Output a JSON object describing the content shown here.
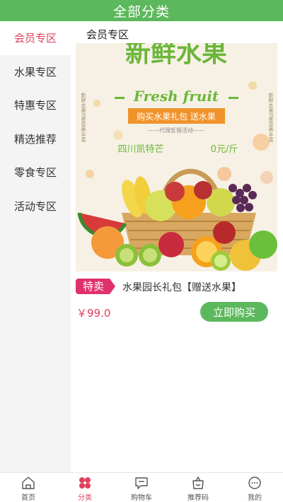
{
  "header": {
    "title": "全部分类"
  },
  "sidebar": {
    "items": [
      {
        "label": "会员专区",
        "active": true
      },
      {
        "label": "水果专区",
        "active": false
      },
      {
        "label": "特惠专区",
        "active": false
      },
      {
        "label": "精选推荐",
        "active": false
      },
      {
        "label": "零食专区",
        "active": false
      },
      {
        "label": "活动专区",
        "active": false
      }
    ]
  },
  "main": {
    "section_title": "会员专区",
    "banner": {
      "headline": "新鲜水果",
      "subtitle": "Fresh fruit",
      "promo": "购买水果礼包  送水果",
      "note": "——代理反馈活动——",
      "product": "四川凯特芒",
      "price": "0元/斤",
      "side_left": "新鲜水果当季营养丰富",
      "side_right": "新鲜水果当季营养丰富"
    },
    "product": {
      "badge": "特卖",
      "name": "水果园长礼包【赠送水果】",
      "price": "￥99.0",
      "buy_label": "立即购买"
    }
  },
  "tabbar": {
    "items": [
      {
        "label": "首页",
        "icon": "home-icon",
        "active": false
      },
      {
        "label": "分类",
        "icon": "category-icon",
        "active": true
      },
      {
        "label": "购物车",
        "icon": "cart-icon",
        "active": false
      },
      {
        "label": "推荐码",
        "icon": "referral-icon",
        "active": false
      },
      {
        "label": "我的",
        "icon": "profile-icon",
        "active": false
      }
    ]
  },
  "colors": {
    "primary": "#5cb85c",
    "accent": "#e0405e",
    "badge": "#e0306e"
  }
}
